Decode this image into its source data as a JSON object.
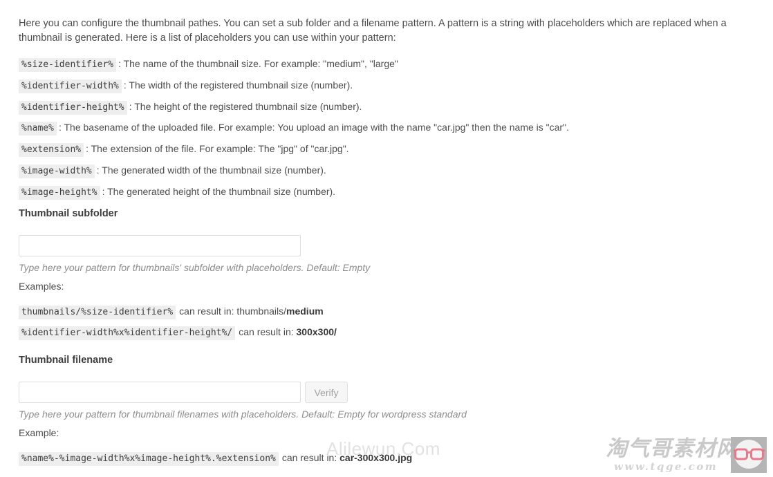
{
  "intro": {
    "paragraph": "Here you can configure the thumbnail pathes. You can set a sub folder and a filename pattern. A pattern is a string with placeholders which are replaced when a thumbnail is generated. Here is a list of placeholders you can use within your pattern:"
  },
  "placeholders": [
    {
      "code": "%size-identifier%",
      "desc": ": The name of the thumbnail size. For example: \"medium\", \"large\""
    },
    {
      "code": "%identifier-width%",
      "desc": ": The width of the registered thumbnail size (number)."
    },
    {
      "code": "%identifier-height%",
      "desc": ": The height of the registered thumbnail size (number)."
    },
    {
      "code": "%name%",
      "desc": ": The basename of the uploaded file. For example: You upload an image with the name \"car.jpg\" then the name is \"car\"."
    },
    {
      "code": "%extension%",
      "desc": ": The extension of the file. For example: The \"jpg\" of \"car.jpg\"."
    },
    {
      "code": "%image-width%",
      "desc": ": The generated width of the thumbnail size (number)."
    },
    {
      "code": "%image-height%",
      "desc": ": The generated height of the thumbnail size (number)."
    }
  ],
  "subfolder": {
    "label": "Thumbnail subfolder",
    "value": "",
    "placeholder": "",
    "hint": "Type here your pattern for thumbnails' subfolder with placeholders. Default: Empty",
    "examples_label": "Examples:",
    "examples": [
      {
        "code": "thumbnails/%size-identifier%",
        "prefix": "can result in: thumbnails/",
        "bold": "medium",
        "suffix": ""
      },
      {
        "code": "%identifier-width%x%identifier-height%/",
        "prefix": "can result in: ",
        "bold": "300x300/",
        "suffix": ""
      }
    ]
  },
  "filename": {
    "label": "Thumbnail filename",
    "value": "",
    "placeholder": "",
    "verify_label": "Verify",
    "hint": "Type here your pattern for thumbnail filenames with placeholders. Default: Empty for wordpress standard",
    "examples_label": "Example:",
    "examples": [
      {
        "code": "%name%-%image-width%x%image-height%.%extension%",
        "prefix": "can result in: ",
        "bold": "car-300x300.jpg",
        "suffix": ""
      }
    ]
  },
  "watermarks": {
    "text": "Alilewun.Com",
    "logo_cn": "淘气哥素材网",
    "logo_url": "www.tqge.com"
  },
  "colors": {
    "code_bg": "#eeeeee",
    "text": "#4c4c4c",
    "hint": "#8d8d8d",
    "input_border": "#dedede",
    "button_bg": "#f6f6f6",
    "watermark": "#e2e2e2",
    "badge_bg": "#b5b5b5",
    "glasses": "#e9798a"
  }
}
